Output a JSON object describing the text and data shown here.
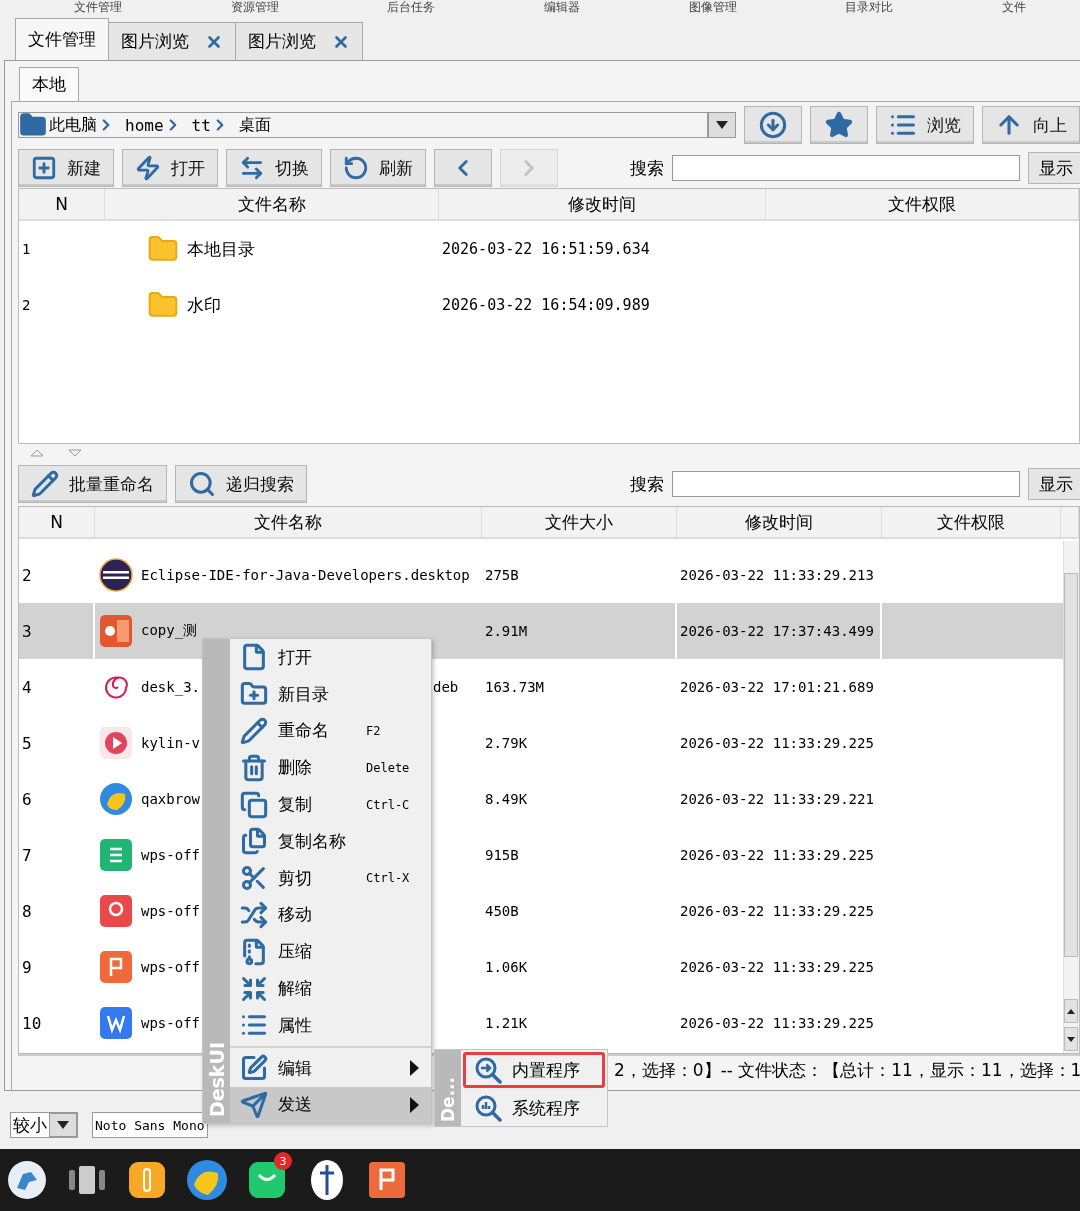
{
  "top_menu": [
    "文件管理",
    "资源管理",
    "后台任务",
    "编辑器",
    "图像管理",
    "目录对比",
    "文件"
  ],
  "tabs": [
    {
      "label": "文件管理",
      "selected": true,
      "closable": false
    },
    {
      "label": "图片浏览",
      "selected": false,
      "closable": true
    },
    {
      "label": "图片浏览",
      "selected": false,
      "closable": true
    }
  ],
  "sub_tabs": [
    {
      "label": "本地",
      "selected": true
    }
  ],
  "path": {
    "crumbs": [
      "此电脑",
      "home",
      "tt",
      "桌面"
    ]
  },
  "path_buttons": [
    {
      "kind": "download"
    },
    {
      "kind": "star"
    },
    {
      "kind": "browse",
      "label": "浏览"
    },
    {
      "kind": "up",
      "label": "向上"
    }
  ],
  "toolbar": {
    "buttons": [
      {
        "kind": "new",
        "label": "新建",
        "disabled": false
      },
      {
        "kind": "open",
        "label": "打开",
        "disabled": false
      },
      {
        "kind": "switch",
        "label": "切换",
        "disabled": false
      },
      {
        "kind": "refresh",
        "label": "刷新",
        "disabled": false
      },
      {
        "kind": "back",
        "disabled": false
      },
      {
        "kind": "forward",
        "disabled": true
      }
    ],
    "search_label": "搜索",
    "show_button": "显示"
  },
  "dir_table": {
    "columns": [
      "N",
      "文件名称",
      "修改时间",
      "文件权限"
    ],
    "rows": [
      {
        "n": "1",
        "kind": "folder",
        "name": "本地目录",
        "modified": "2026-03-22 16:51:59.634"
      },
      {
        "n": "2",
        "kind": "folder",
        "name": "水印",
        "modified": "2026-03-22 16:54:09.989"
      }
    ]
  },
  "file_toolbar": {
    "buttons": [
      {
        "kind": "rename",
        "label": "批量重命名"
      },
      {
        "kind": "search",
        "label": "递归搜索"
      }
    ],
    "search_label": "搜索",
    "show_button": "显示"
  },
  "file_table": {
    "columns": [
      "N",
      "文件名称",
      "文件大小",
      "修改时间",
      "文件权限"
    ],
    "rows": [
      {
        "n": "2",
        "kind": "eclipse",
        "name": "Eclipse-IDE-for-Java-Developers.desktop",
        "size": "275B",
        "modified": "2026-03-22 11:33:29.213",
        "selected": false
      },
      {
        "n": "3",
        "kind": "pptx",
        "name": "copy_测",
        "size": "2.91M",
        "modified": "2026-03-22 17:37:43.499",
        "selected": true
      },
      {
        "n": "4",
        "kind": "deb",
        "name": "desk_3.",
        "name_tail": "deb",
        "size": "163.73M",
        "modified": "2026-03-22 17:01:21.689",
        "selected": false
      },
      {
        "n": "5",
        "kind": "video",
        "name": "kylin-v",
        "size": "2.79K",
        "modified": "2026-03-22 11:33:29.225",
        "selected": false
      },
      {
        "n": "6",
        "kind": "browser",
        "name": "qaxbrow",
        "size": "8.49K",
        "modified": "2026-03-22 11:33:29.221",
        "selected": false
      },
      {
        "n": "7",
        "kind": "sheet",
        "name": "wps-off",
        "size": "915B",
        "modified": "2026-03-22 11:33:29.225",
        "selected": false
      },
      {
        "n": "8",
        "kind": "pdf",
        "name": "wps-off",
        "size": "450B",
        "modified": "2026-03-22 11:33:29.225",
        "selected": false
      },
      {
        "n": "9",
        "kind": "slides",
        "name": "wps-off",
        "size": "1.06K",
        "modified": "2026-03-22 11:33:29.225",
        "selected": false
      },
      {
        "n": "10",
        "kind": "doc",
        "name": "wps-off",
        "size": "1.21K",
        "modified": "2026-03-22 11:33:29.225",
        "selected": false
      }
    ]
  },
  "status_bar": "2，选择：0】-- 文件状态：【总计：11，显示：11，选择：1",
  "bottom_bar": {
    "font_size": "较小",
    "font_name": "Noto Sans Mono"
  },
  "context_menu": {
    "side_label": "DeskUI",
    "items": [
      {
        "kind": "item",
        "label": "打开",
        "selected": false
      },
      {
        "kind": "item",
        "label": "新目录",
        "selected": false
      },
      {
        "kind": "item",
        "label": "重命名",
        "shortcut": "F2",
        "selected": false
      },
      {
        "kind": "item",
        "label": "删除",
        "shortcut": "Delete",
        "selected": false
      },
      {
        "kind": "item",
        "label": "复制",
        "shortcut": "Ctrl-C",
        "selected": false
      },
      {
        "kind": "item",
        "label": "复制名称",
        "selected": false
      },
      {
        "kind": "item",
        "label": "剪切",
        "shortcut": "Ctrl-X",
        "selected": false
      },
      {
        "kind": "item",
        "label": "移动",
        "selected": false
      },
      {
        "kind": "item",
        "label": "压缩",
        "selected": false
      },
      {
        "kind": "item",
        "label": "解缩",
        "selected": false
      },
      {
        "kind": "item",
        "label": "属性",
        "selected": false
      },
      {
        "kind": "separator"
      },
      {
        "kind": "submenu",
        "label": "编辑",
        "selected": false
      },
      {
        "kind": "submenu",
        "label": "发送",
        "selected": true
      }
    ],
    "submenu": {
      "side_label": "De...",
      "items": [
        {
          "label": "内置程序",
          "selected": true
        },
        {
          "label": "系统程序",
          "selected": false
        }
      ]
    }
  },
  "taskbar": {
    "badge": "3"
  }
}
